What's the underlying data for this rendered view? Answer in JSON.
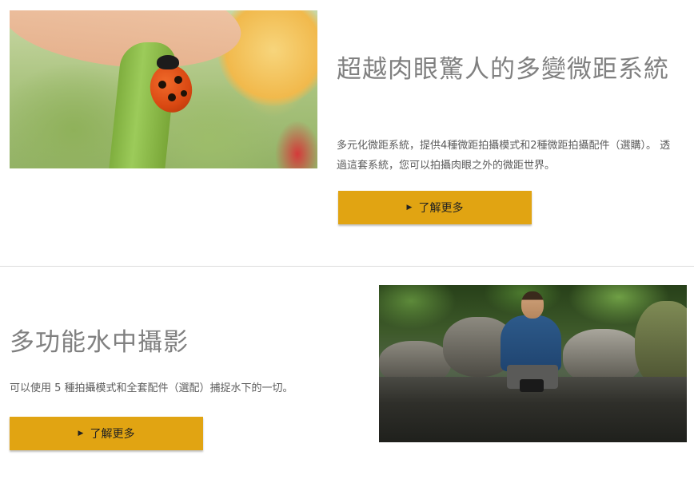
{
  "sections": [
    {
      "title": "超越肉眼驚人的多變微距系統",
      "description": "多元化微距系統，提供4種微距拍攝模式和2種微距拍攝配件（選購）。 透過這套系統，您可以拍攝肉眼之外的微距世界。",
      "button_label": "了解更多",
      "button_icon": "play-triangle-icon"
    },
    {
      "title": "多功能水中攝影",
      "description": "可以使用 5 種拍攝模式和全套配件（選配）捕捉水下的一切。",
      "button_label": "了解更多",
      "button_icon": "play-triangle-icon"
    }
  ],
  "colors": {
    "button": "#e1a412",
    "heading": "#808080",
    "body_text": "#5c5c5c",
    "divider": "#dcdcdc"
  }
}
